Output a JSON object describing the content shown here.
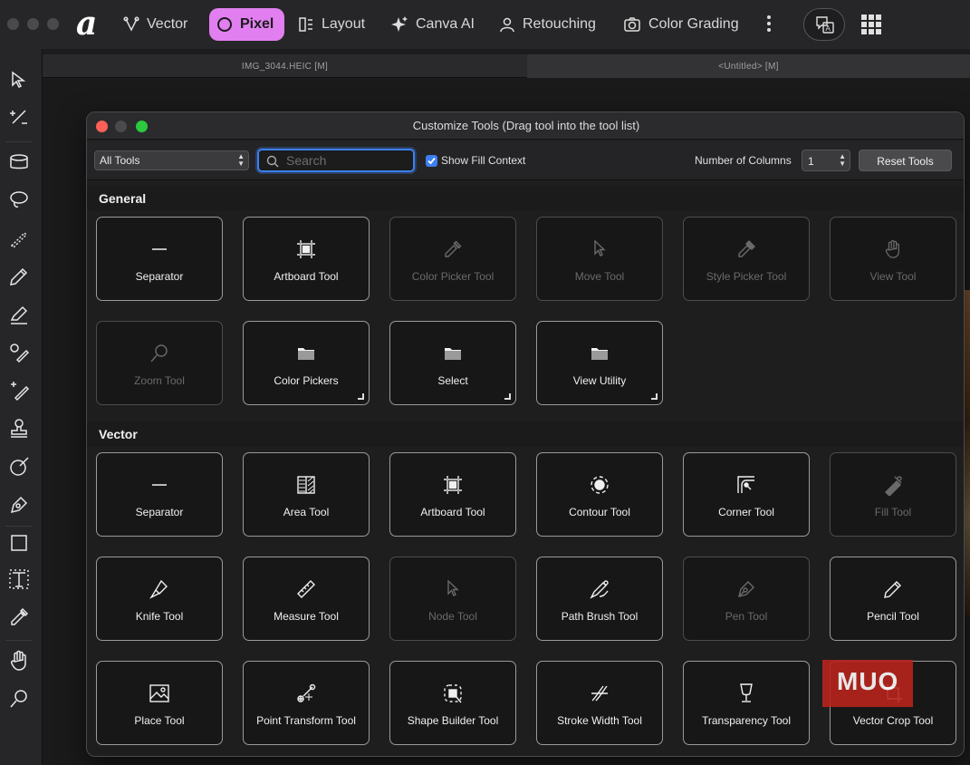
{
  "topbar": {
    "personas": [
      {
        "label": "Vector",
        "active": false
      },
      {
        "label": "Pixel",
        "active": true
      },
      {
        "label": "Layout",
        "active": false
      },
      {
        "label": "Canva AI",
        "active": false
      },
      {
        "label": "Retouching",
        "active": false
      },
      {
        "label": "Color Grading",
        "active": false
      }
    ],
    "accent_color": "#e27ff0"
  },
  "documents": {
    "tab1": "IMG_3044.HEIC [M]",
    "tab2": "<Untitled> [M]"
  },
  "dialog": {
    "title": "Customize Tools (Drag tool into the tool list)",
    "filter_value": "All Tools",
    "search_placeholder": "Search",
    "show_fill_context_label": "Show Fill Context",
    "show_fill_context_checked": true,
    "columns_label": "Number of Columns",
    "columns_value": "1",
    "reset_label": "Reset Tools",
    "sections": [
      {
        "title": "General",
        "tools": [
          {
            "label": "Separator",
            "icon": "separator-icon",
            "enabled": true
          },
          {
            "label": "Artboard Tool",
            "icon": "artboard-icon",
            "enabled": true
          },
          {
            "label": "Color Picker Tool",
            "icon": "color-picker-icon",
            "enabled": false
          },
          {
            "label": "Move Tool",
            "icon": "move-icon",
            "enabled": false
          },
          {
            "label": "Style Picker Tool",
            "icon": "style-picker-icon",
            "enabled": false
          },
          {
            "label": "View Tool",
            "icon": "hand-icon",
            "enabled": false
          },
          {
            "label": "Zoom Tool",
            "icon": "zoom-icon",
            "enabled": false
          },
          {
            "label": "Color Pickers",
            "icon": "folder-icon",
            "enabled": true,
            "group": true
          },
          {
            "label": "Select",
            "icon": "folder-icon",
            "enabled": true,
            "group": true
          },
          {
            "label": "View Utility",
            "icon": "folder-icon",
            "enabled": true,
            "group": true
          }
        ]
      },
      {
        "title": "Vector",
        "tools": [
          {
            "label": "Separator",
            "icon": "separator-icon",
            "enabled": true
          },
          {
            "label": "Area Tool",
            "icon": "area-icon",
            "enabled": true
          },
          {
            "label": "Artboard Tool",
            "icon": "artboard-icon",
            "enabled": true
          },
          {
            "label": "Contour Tool",
            "icon": "contour-icon",
            "enabled": true
          },
          {
            "label": "Corner Tool",
            "icon": "corner-icon",
            "enabled": true
          },
          {
            "label": "Fill Tool",
            "icon": "fill-icon",
            "enabled": false
          },
          {
            "label": "Knife Tool",
            "icon": "knife-icon",
            "enabled": true
          },
          {
            "label": "Measure Tool",
            "icon": "measure-icon",
            "enabled": true
          },
          {
            "label": "Node Tool",
            "icon": "node-icon",
            "enabled": false
          },
          {
            "label": "Path Brush Tool",
            "icon": "path-brush-icon",
            "enabled": true
          },
          {
            "label": "Pen Tool",
            "icon": "pen-icon",
            "enabled": false
          },
          {
            "label": "Pencil Tool",
            "icon": "pencil-icon",
            "enabled": true
          },
          {
            "label": "Place Tool",
            "icon": "place-icon",
            "enabled": true
          },
          {
            "label": "Point Transform Tool",
            "icon": "point-transform-icon",
            "enabled": true
          },
          {
            "label": "Shape Builder Tool",
            "icon": "shape-builder-icon",
            "enabled": true
          },
          {
            "label": "Stroke Width Tool",
            "icon": "stroke-width-icon",
            "enabled": true
          },
          {
            "label": "Transparency Tool",
            "icon": "transparency-icon",
            "enabled": true
          },
          {
            "label": "Vector Crop Tool",
            "icon": "vector-crop-icon",
            "enabled": true
          }
        ]
      }
    ]
  },
  "watermark": "MUO"
}
